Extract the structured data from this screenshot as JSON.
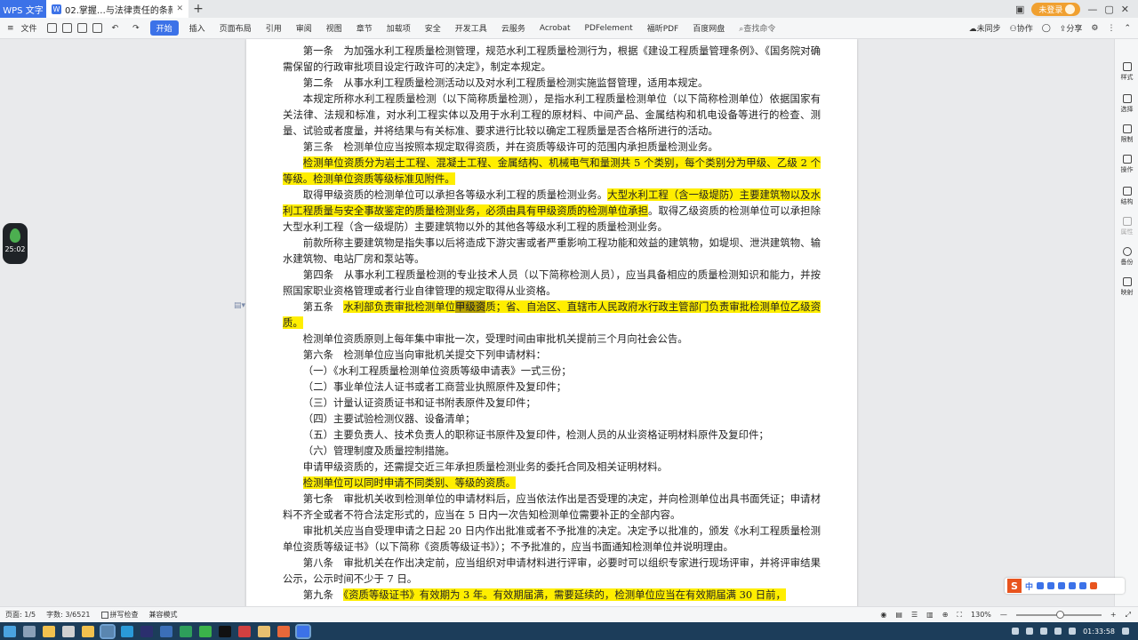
{
  "titlebar": {
    "app": "WPS 文字",
    "doc_tab": "02.掌握…与法律责任的条款.",
    "login": "未登录"
  },
  "menubar": {
    "file": "文件",
    "tabs": [
      "开始",
      "插入",
      "页面布局",
      "引用",
      "审阅",
      "视图",
      "章节",
      "加载项",
      "安全",
      "开发工具",
      "云服务",
      "Acrobat",
      "PDFelement",
      "福昕PDF",
      "百度网盘"
    ],
    "active_tab": "开始",
    "search": "查找命令",
    "sync": "未同步",
    "collab": "协作",
    "share": "分享"
  },
  "document": {
    "p1": "第一条　为加强水利工程质量检测管理，规范水利工程质量检测行为，根据《建设工程质量管理条例》、《国务院对确需保留的行政审批项目设定行政许可的决定》，制定本规定。",
    "p2": "第二条　从事水利工程质量检测活动以及对水利工程质量检测实施监督管理，适用本规定。",
    "p3": "本规定所称水利工程质量检测（以下简称质量检测），是指水利工程质量检测单位（以下简称检测单位）依据国家有关法律、法规和标准，对水利工程实体以及用于水利工程的原材料、中间产品、金属结构和机电设备等进行的检查、测量、试验或者度量，并将结果与有关标准、要求进行比较以确定工程质量是否合格所进行的活动。",
    "p4": "第三条　检测单位应当按照本规定取得资质，并在资质等级许可的范围内承担质量检测业务。",
    "p5": "检测单位资质分为岩土工程、混凝土工程、金属结构、机械电气和量测共 5 个类别，每个类别分为甲级、乙级 2 个等级。检测单位资质等级标准见附件。",
    "p6_a": "取得甲级资质的检测单位可以承担各等级水利工程的质量检测业务。",
    "p6_hl": "大型水利工程（含一级堤防）主要建筑物以及水利工程质量与安全事故鉴定的质量检测业务，必须由具有甲级资质的检测单位承担",
    "p6_b": "。取得乙级资质的检测单位可以承担除大型水利工程（含一级堤防）主要建筑物以外的其他各等级水利工程的质量检测业务。",
    "p7": "前款所称主要建筑物是指失事以后将造成下游灾害或者严重影响工程功能和效益的建筑物，如堤坝、泄洪建筑物、输水建筑物、电站厂房和泵站等。",
    "p8": "第四条　从事水利工程质量检测的专业技术人员（以下简称检测人员），应当具备相应的质量检测知识和能力，并按照国家职业资格管理或者行业自律管理的规定取得从业资格。",
    "p9_a": "第五条　",
    "p9_hl1": "水利部负责审批检测单位",
    "p9_hlg": "甲级资",
    "p9_hl2": "质；省、自治区、直辖市人民政府水行政主管部门负责审批检测单位乙级资质。",
    "p10": "检测单位资质原则上每年集中审批一次，受理时间由审批机关提前三个月向社会公告。",
    "p11": "第六条　检测单位应当向审批机关提交下列申请材料：",
    "l1": "（一）《水利工程质量检测单位资质等级申请表》一式三份；",
    "l2": "（二）事业单位法人证书或者工商营业执照原件及复印件；",
    "l3": "（三）计量认证资质证书和证书附表原件及复印件；",
    "l4": "（四）主要试验检测仪器、设备清单；",
    "l5": "（五）主要负责人、技术负责人的职称证书原件及复印件，检测人员的从业资格证明材料原件及复印件；",
    "l6": "（六）管理制度及质量控制措施。",
    "p12": "申请甲级资质的，还需提交近三年承担质量检测业务的委托合同及相关证明材料。",
    "p13": "检测单位可以同时申请不同类别、等级的资质。",
    "p14": "第七条　审批机关收到检测单位的申请材料后，应当依法作出是否受理的决定，并向检测单位出具书面凭证；申请材料不齐全或者不符合法定形式的，应当在 5 日内一次告知检测单位需要补正的全部内容。",
    "p15": "审批机关应当自受理申请之日起 20 日内作出批准或者不予批准的决定。决定予以批准的，颁发《水利工程质量检测单位资质等级证书》（以下简称《资质等级证书》）；不予批准的，应当书面通知检测单位并说明理由。",
    "p16": "第八条　审批机关在作出决定前，应当组织对申请材料进行评审，必要时可以组织专家进行现场评审，并将评审结果公示，公示时间不少于 7 日。",
    "p17_a": "第九条　",
    "p17_hl": "《资质等级证书》有效期为 3 年。有效期届满，需要延续的，检测单位应当在有效期届满 30 日前，"
  },
  "sidebar": [
    "样式",
    "选择",
    "限制",
    "操作",
    "结构",
    "属性",
    "备份",
    "映射"
  ],
  "timer": "25:02",
  "ime": {
    "logo": "S",
    "mode": "中"
  },
  "statusbar": {
    "page": "页面: 1/5",
    "words": "字数: 3/6521",
    "spell": "拼写检查",
    "compat": "兼容模式",
    "zoom": "130%"
  },
  "taskbar": {
    "time": "01:33:58"
  }
}
